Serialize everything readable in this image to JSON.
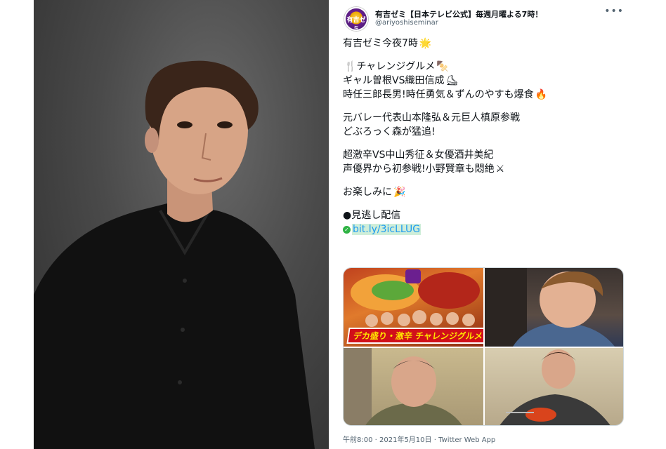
{
  "tweet": {
    "display_name": "有吉ゼミ【日本テレビ公式】毎週月曜よる7時！",
    "handle": "@ariyoshiseminar",
    "avatar_text": "有吉ゼミ",
    "more_icon": "more-icon",
    "lines": {
      "l1": "有吉ゼミ今夜7時",
      "l2": "チャレンジグルメ",
      "l3": "ギャル曽根VS織田信成",
      "l4": "時任三郎長男!時任勇気＆ずんのやすも爆食",
      "l5": "元バレー代表山本隆弘＆元巨人槙原参戦",
      "l6": "どぶろっく森が猛追!",
      "l7": "超激辛VS中山秀征＆女優酒井美紀",
      "l8": "声優界から初参戦!小野賢章も悶絶",
      "l9": "お楽しみに",
      "l10": "●見逃し配信"
    },
    "emoji": {
      "sun": "🌟",
      "fork": "🍴",
      "skewer": "🍢",
      "skate": "⛸",
      "fire": "🔥",
      "swords": "⚔",
      "party": "🎉",
      "check": "✓"
    },
    "link": "bit.ly/3icLLUG",
    "media_banner": "デカ盛り・激辛 チャレンジグルメ",
    "timestamp": "午前8:00 · 2021年5月10日 · Twitter Web App"
  }
}
